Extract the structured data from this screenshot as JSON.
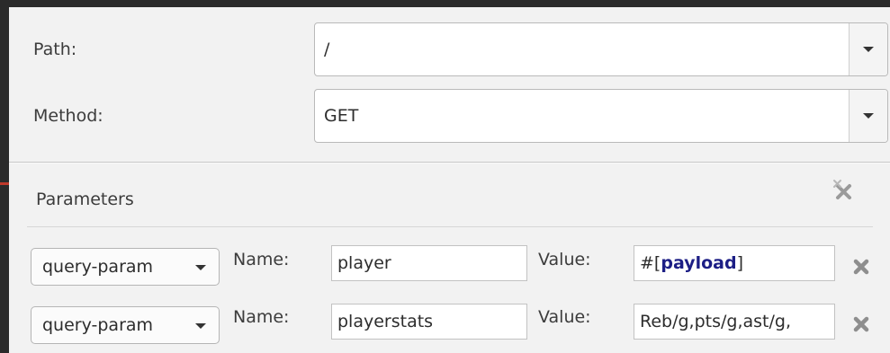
{
  "request": {
    "path_label": "Path:",
    "path_value": "/",
    "method_label": "Method:",
    "method_value": "GET"
  },
  "parameters": {
    "title": "Parameters",
    "rows": [
      {
        "type": "query-param",
        "name_label": "Name:",
        "name_value": "player",
        "value_label": "Value:",
        "value_prefix": "#[",
        "value_keyword": "payload",
        "value_suffix": "]"
      },
      {
        "type": "query-param",
        "name_label": "Name:",
        "name_value": "playerstats",
        "value_label": "Value:",
        "value_text": "Reb/g,pts/g,ast/g,"
      }
    ]
  },
  "icons": {
    "dropdown": "chevron-down-icon",
    "remove": "close-icon",
    "clear_all": "clear-all-icon"
  },
  "colors": {
    "expression_keyword": "#1c1e85",
    "panel_background": "#f2f2f2",
    "window_frame": "#2b2b2b"
  }
}
